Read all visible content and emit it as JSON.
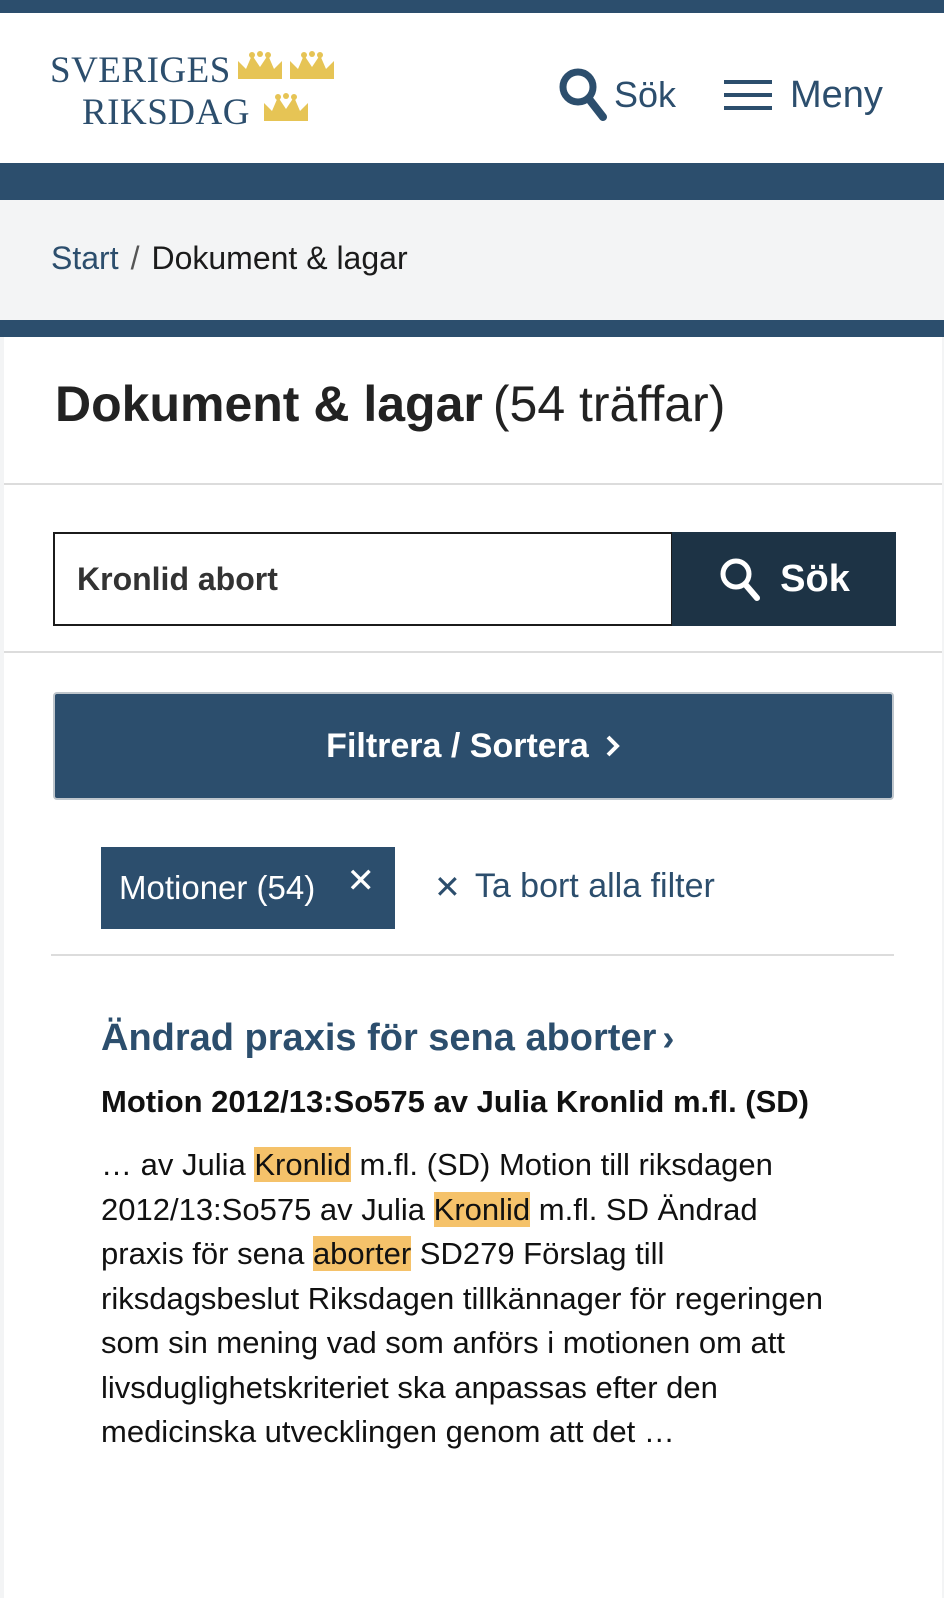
{
  "header": {
    "logo_line1": "SVERIGES",
    "logo_line2": "RIKSDAG",
    "search_label": "Sök",
    "menu_label": "Meny"
  },
  "breadcrumb": {
    "start": "Start",
    "separator": "/",
    "current": "Dokument & lagar"
  },
  "page": {
    "title": "Dokument & lagar",
    "hit_count": "(54 träffar)"
  },
  "search": {
    "value": "Kronlid abort",
    "button_label": "Sök"
  },
  "filter": {
    "button_label": "Filtrera / Sortera"
  },
  "active_filters": {
    "chip_label": "Motioner (54)",
    "chip_remove": "✕",
    "clear_icon": "✕",
    "clear_all_label": "Ta bort alla filter"
  },
  "result": {
    "title": "Ändrad praxis för sena aborter",
    "arrow": "›",
    "subtitle": "Motion 2012/13:So575 av Julia Kronlid m.fl. (SD)",
    "snippet": [
      {
        "text": "… av Julia ",
        "hl": false
      },
      {
        "text": "Kronlid",
        "hl": true
      },
      {
        "text": " m.fl. (SD) Motion till riksdagen 2012/13:So575 av Julia ",
        "hl": false
      },
      {
        "text": "Kronlid",
        "hl": true
      },
      {
        "text": " m.fl. SD Ändrad praxis för sena ",
        "hl": false
      },
      {
        "text": "aborter",
        "hl": true
      },
      {
        "text": " SD279 Förslag till riksdagsbeslut Riksdagen tillkännager för regeringen som sin mening vad som anförs i motionen om att livsduglighetskriteriet ska anpassas efter den medicinska utvecklingen genom att det …",
        "hl": false
      }
    ]
  },
  "colors": {
    "brand_blue": "#2c4e6d",
    "search_button": "#1d3345",
    "crown_gold": "#e6c455",
    "highlight": "#f5c26a"
  },
  "icons": {
    "logo_crowns": "three-crowns-icon",
    "search": "search-icon",
    "menu": "hamburger-menu-icon",
    "filter_chevron": "chevron-right-icon",
    "remove": "close-icon"
  }
}
